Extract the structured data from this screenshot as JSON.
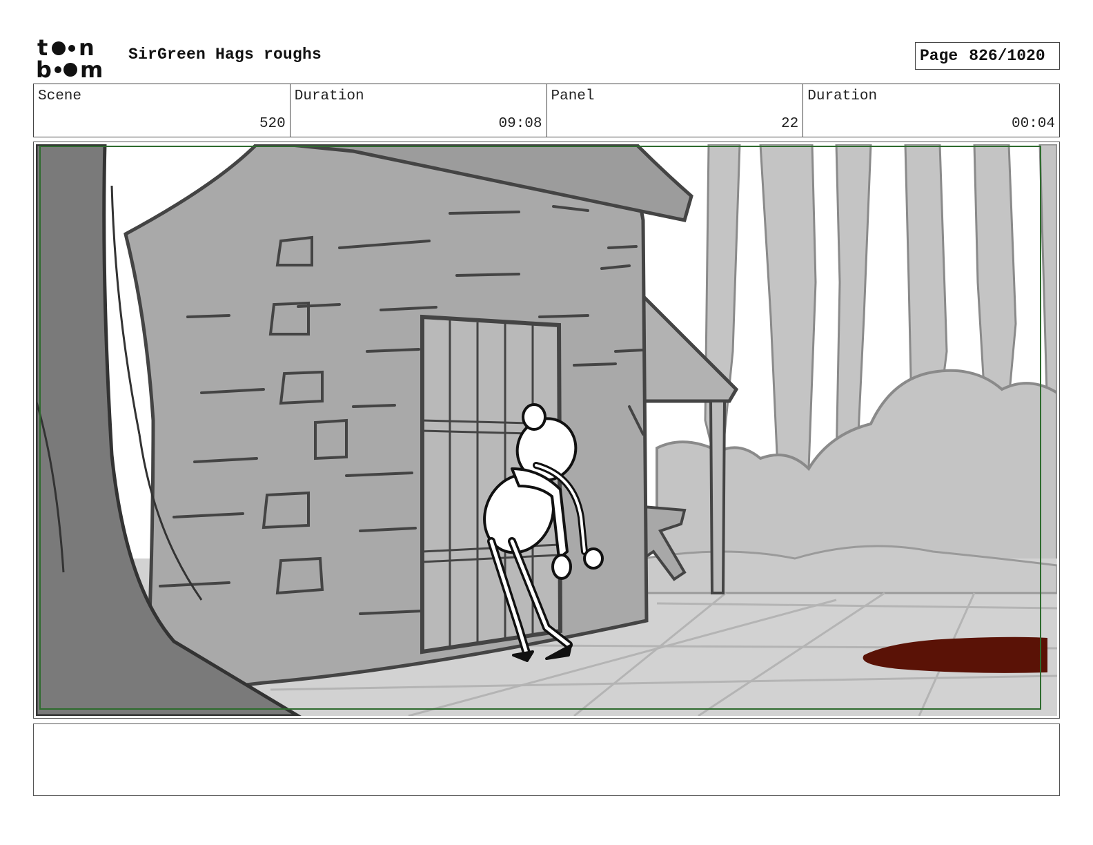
{
  "header": {
    "logo_text": "toon boom",
    "project_title": "SirGreen Hags roughs",
    "page_label": "Page",
    "page_value": "826/1020"
  },
  "info": {
    "scene_label": "Scene",
    "scene_value": "520",
    "scene_duration_label": "Duration",
    "scene_duration_value": "09:08",
    "panel_label": "Panel",
    "panel_value": "22",
    "panel_duration_label": "Duration",
    "panel_duration_value": "00:04"
  },
  "panel": {
    "safe_frame_color": "#2e6b2e",
    "blood_color": "#5a1206"
  },
  "notes": {
    "text": ""
  }
}
